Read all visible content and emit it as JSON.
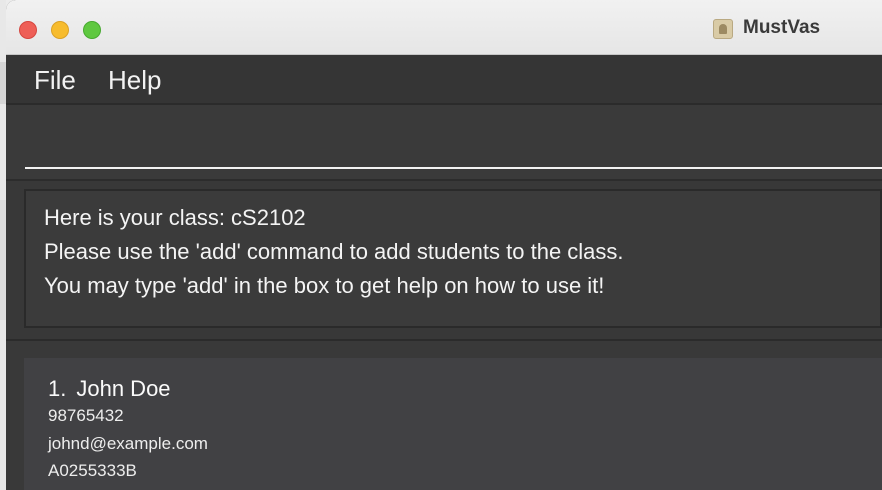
{
  "window": {
    "title": "MustVas"
  },
  "menu": {
    "file": "File",
    "help": "Help"
  },
  "command_box": {
    "value": "",
    "placeholder": ""
  },
  "result_display": {
    "lines": [
      "Here is your class: cS2102",
      "Please use the 'add' command to add students to the class.",
      "You may type 'add' in the box to get help on how to use it!"
    ]
  },
  "student_list": {
    "items": [
      {
        "index": "1.",
        "name": "John Doe",
        "phone": "98765432",
        "email": "johnd@example.com",
        "student_id": "A0255333B"
      }
    ]
  },
  "colors": {
    "traffic_close": "#ee5f57",
    "traffic_minimize": "#f7bc2e",
    "traffic_maximize": "#5fc840",
    "panel_background": "#393939",
    "card_background": "#414144",
    "text": "#f4f4f4"
  },
  "icons": {
    "app": "app-icon"
  }
}
